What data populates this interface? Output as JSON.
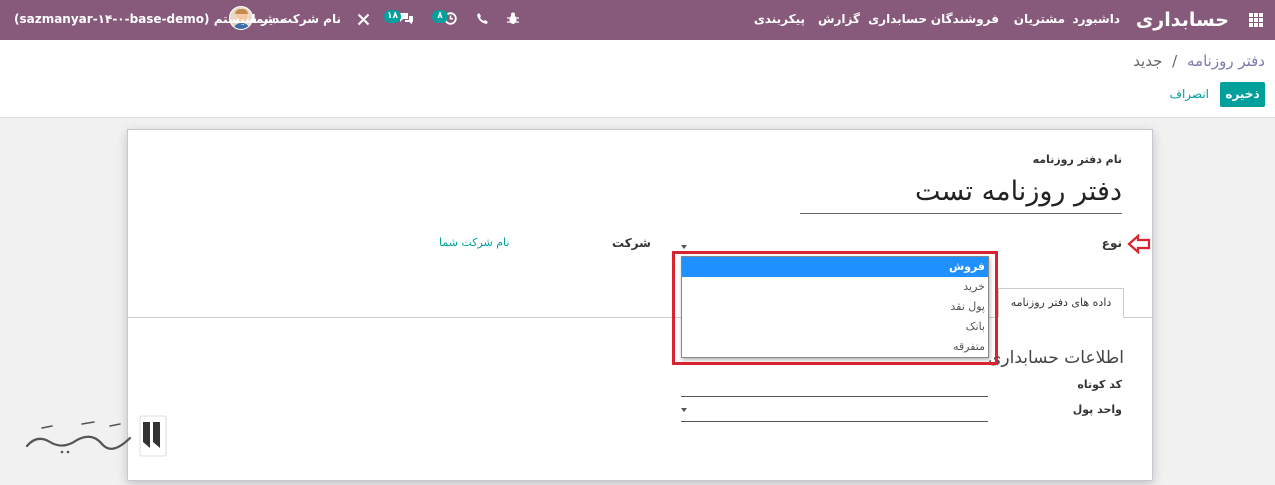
{
  "navbar": {
    "app_title": "حسابداری",
    "menu": [
      "داشبورد",
      "مشتریان",
      "فروشندگان",
      "حسابداری",
      "گزارش",
      "پیکربندی"
    ],
    "company": "نام شرکت شما",
    "user": "مدیر سیستم (sazmanyar-۱۴-۰-base-demo)",
    "activity_count": "۸",
    "messages_count": "۱۸",
    "bar_color": "#875a7b",
    "icons": [
      "apps-grid-icon",
      "bug-icon",
      "phone-icon",
      "clock-icon",
      "chat-icon",
      "tools-icon",
      "user-avatar"
    ]
  },
  "breadcrumb": {
    "parent": "دفتر روزنامه",
    "separator": "/",
    "current": "جدید"
  },
  "buttons": {
    "save": "ذخیره",
    "discard": "انصراف"
  },
  "form": {
    "name_label": "نام دفتر روزنامه",
    "name_value": "دفتر روزنامه تست",
    "type_label": "نوع",
    "company_label": "شرکت",
    "company_value": "نام شرکت شما",
    "tab_label": "داده های دفتر روزنامه",
    "section_title": "اطلاعات حسابداری",
    "short_code_label": "کد کوتاه",
    "currency_label": "واحد پول"
  },
  "type_dropdown": {
    "options": [
      "فروش",
      "خرید",
      "پول نقد",
      "بانک",
      "متفرقه"
    ],
    "selected": "فروش"
  },
  "colors": {
    "accent": "#00a09d",
    "highlight": "#d9232e",
    "selection": "#1e90ff"
  }
}
